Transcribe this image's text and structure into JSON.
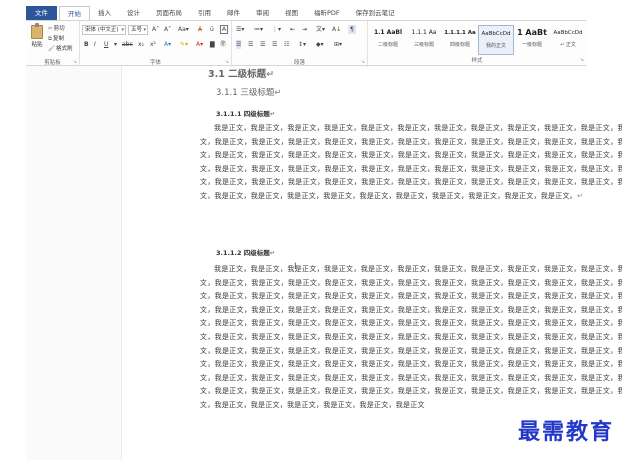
{
  "tabs": [
    {
      "label": "文件"
    },
    {
      "label": "开始"
    },
    {
      "label": "插入"
    },
    {
      "label": "设计"
    },
    {
      "label": "页面布局"
    },
    {
      "label": "引用"
    },
    {
      "label": "邮件"
    },
    {
      "label": "审阅"
    },
    {
      "label": "视图"
    },
    {
      "label": "福昕PDF"
    },
    {
      "label": "保存到云笔记"
    }
  ],
  "clipboard": {
    "paste": "粘贴",
    "cut": "剪切",
    "copy": "复制",
    "format_painter": "格式刷",
    "group_label": "剪贴板"
  },
  "font": {
    "family": "宋体 (中文正)",
    "size": "五号",
    "group_label": "字体"
  },
  "paragraph": {
    "group_label": "段落"
  },
  "styles": {
    "group_label": "样式",
    "items": [
      {
        "preview": "1.1 AaBl",
        "name": "二级标题"
      },
      {
        "preview": "1.1.1 Aa",
        "name": "三级标题"
      },
      {
        "preview": "1.1.1.1 Aa",
        "name": "四级标题"
      },
      {
        "preview": "AaBbCcDd",
        "name": "我的正文"
      },
      {
        "preview": "1 AaBt",
        "name": "一级标题"
      },
      {
        "preview": "AaBbCcDd",
        "name": "↵ 正文"
      }
    ]
  },
  "document": {
    "h2": "3.1 二级标题",
    "h3": "3.1.1 三级标题",
    "h4_a": "3.1.1.1 四级标题",
    "para_a": "我是正文，我是正文，我是正文，我是正文，我是正文，我是正文，我是正文，我是正文，我是正文，我是正文，我是正文，我是正文，我是正文，我是正文，我是正文，我是正文，我是正文，我是正文，我是正文，我是正文，我是正文，我是正文，我是正文，我是正文，我是正文，我是正文，我是正文，我是正文，我是正文，我是正文，我是正文，我是正文，我是正文，我是正文，我是正文，我是正文，我是正文，我是正文，我是正文，我是正文，我是正文，我是正文，我是正文，我是正文，我是正文，我是正文，我是正文，我是正文，我是正文，我是正文，我是正文，我是正文，我是正文，我是正文，我是正文，我是正文，我是正文，我是正文，我是正文，我是正文，我是正文，我是正文，我是正文，我是正文，我是正文，我是正文，我是正文，我是正文，我是正文，我是正文，我是正文，我是正文，我是正文，我是正文，我是正文。",
    "h4_b": "3.1.1.2 四级标题",
    "para_b": "我是正文，我是正文，我是正文，我是正文，我是正文，我是正文，我是正文，我是正文，我是正文，我是正文，我是正文，我是正文，我是正文，我是正文，我是正文，我是正文，我是正文，我是正文，我是正文，我是正文，我是正文，我是正文，我是正文，我是正文，我是正文，我是正文，我是正文，我是正文，我是正文，我是正文，我是正文，我是正文，我是正文，我是正文，我是正文，我是正文，我是正文，我是正文，我是正文，我是正文，我是正文，我是正文，我是正文，我是正文，我是正文，我是正文，我是正文，我是正文，我是正文，我是正文，我是正文，我是正文，我是正文，我是正文，我是正文，我是正文，我是正文，我是正文，我是正文，我是正文，我是正文，我是正文，我是正文，我是正文，我是正文，我是正文，我是正文，我是正文，我是正文，我是正文，我是正文，我是正文，我是正文，我是正文，我是正文，我是正文，我是正文，我是正文，我是正文，我是正文，我是正文，我是正文，我是正文，我是正文，我是正文，我是正文，我是正文，我是正文，我是正文，我是正文，我是正文，我是正文，我是正文，我是正文，我是正文，我是正文，我是正文，我是正文，我是正文，我是正文，我是正文，我是正文，我是正文，我是正文，我是正文，我是正文，我是正文，我是正文，我是正文，我是正文，我是正文，我是正文，我是正文，我是正文，我是正文，我是正文，我是正文，我是正文，我是正文，我是正文，我是正文，我是正文，我是正文，我是正文，我是正文，我是正文，我是正文，我是正文，我是正文，我是正文，我是正文，我是正文，我是正文，我是正文，我是正文，我是正文"
  },
  "watermark": "最需教育"
}
